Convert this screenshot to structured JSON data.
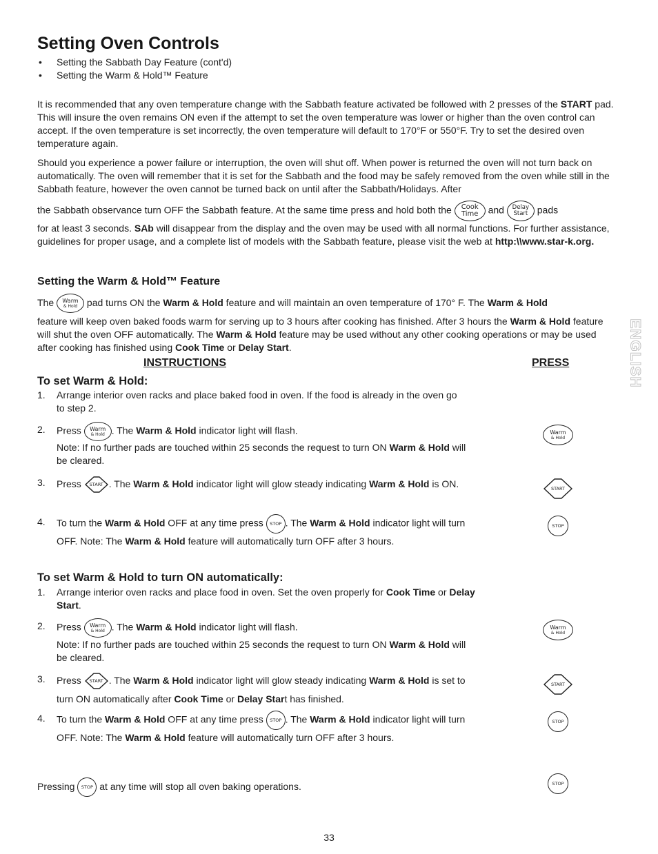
{
  "page": {
    "title": "Setting Oven Controls",
    "bullets": [
      "Setting the Sabbath Day Feature (cont'd)",
      "Setting the Warm & Hold™ Feature"
    ],
    "side_tab": "ENGLISH",
    "page_number": "33"
  },
  "pads": {
    "warm_line1": "Warm",
    "warm_line2": "& Hold",
    "start": "START",
    "stop": "STOP",
    "cook_line1": "Cook",
    "cook_line2": "Time",
    "delay_line1": "Delay",
    "delay_line2": "Start"
  },
  "sabbath": {
    "para1": {
      "a": "It is recommended that any oven temperature change with the Sabbath feature activated be followed with 2 presses of the ",
      "b": "START",
      "c": " pad. This will insure the oven remains ON even if the attempt to set the oven temperature was lower or higher than the oven control can accept. If the oven temperature is set incorrectly, the oven temperature will default to 170°F or 550°F. Try to set the desired oven temperature again."
    },
    "para2": {
      "a": "Should you experience a power failure or interruption, the oven will shut off. When power is returned the oven will not turn back on automatically. The oven will remember that it is set for the Sabbath and the food may be safely removed from the oven while still in the Sabbath feature, however the oven cannot be turned back on until after the Sabbath/Holidays. After",
      "b": "the Sabbath observance turn OFF the Sabbath feature. At the same time press and hold both the ",
      "c": " and ",
      "d": " pads",
      "e": "for at least 3 seconds. ",
      "f": "SAb",
      "g": " will disappear from the display and the oven may be used with all normal functions. For further assistance, guidelines for proper usage, and a complete list of models with the Sabbath feature, please visit the web at ",
      "h": "http:\\\\www.star-k.org."
    }
  },
  "warm_hold": {
    "heading": "Setting the Warm & Hold™ Feature",
    "intro": {
      "a": "The ",
      "b": " pad turns ON the ",
      "c": "Warm & Hold",
      "d": " feature and will maintain an oven temperature of 170° F. The ",
      "e": "Warm & Hold",
      "f": "feature will keep oven baked foods warm for serving up to 3 hours after cooking has finished. After 3 hours the ",
      "g": "Warm & Hold",
      "h": " feature will shut the oven OFF automatically. The ",
      "i": "Warm & Hold",
      "j": " feature may be used without any other cooking operations or may be used after cooking has finished using ",
      "k": "Cook Time",
      "l": " or ",
      "m": "Delay Start",
      "n": "."
    },
    "col_instructions": "INSTRUCTIONS",
    "col_press": "PRESS",
    "section1": {
      "heading": "To set Warm & Hold:",
      "steps": [
        {
          "num": "1.",
          "text": "Arrange interior oven racks and place baked food in oven. If the food is already in the oven go to step 2."
        },
        {
          "num": "2.",
          "a": "Press ",
          "b": ". The ",
          "c": "Warm & Hold",
          "d": " indicator light will flash.",
          "note_a": "Note: If no further pads are touched within 25 seconds the request to turn ON ",
          "note_b": "Warm & Hold",
          "note_c": " will be cleared.",
          "press": "warm"
        },
        {
          "num": "3.",
          "a": "Press ",
          "b": ". The ",
          "c": "Warm & Hold",
          "d": " indicator light will glow steady indicating ",
          "e": "Warm & Hold",
          "f": " is ON.",
          "press": "start"
        },
        {
          "num": "4.",
          "a": "To turn the ",
          "b": "Warm & Hold",
          "c": " OFF at any time press ",
          "d": ".  The ",
          "e": "Warm & Hold",
          "f": " indicator light will turn OFF. Note: The ",
          "g": "Warm & Hold",
          "h": " feature will automatically turn OFF after 3 hours.",
          "press": "stop"
        }
      ]
    },
    "section2": {
      "heading": "To set Warm & Hold to turn ON automatically:",
      "steps": [
        {
          "num": "1.",
          "a": "Arrange interior oven racks and place food in oven. Set the oven properly for ",
          "b": "Cook Time",
          "c": " or ",
          "d": "Delay Start",
          "e": "."
        },
        {
          "num": "2.",
          "a": "Press ",
          "b": ". The ",
          "c": "Warm & Hold",
          "d": " indicator light will flash.",
          "note_a": "Note: If no further pads are touched within 25 seconds the request to turn ON ",
          "note_b": "Warm & Hold",
          "note_c": " will be cleared.",
          "press": "warm"
        },
        {
          "num": "3.",
          "a": "Press ",
          "b": ". The ",
          "c": "Warm & Hold",
          "d": " indicator light will glow steady indicating ",
          "e": "Warm & Hold",
          "f": " is set to turn ON automatically after ",
          "g": "Cook Time",
          "h": " or ",
          "i": "Delay Star",
          "j": "t has finished.",
          "press": "start"
        },
        {
          "num": "4.",
          "a": "To turn the ",
          "b": "Warm & Hold",
          "c": " OFF at any time press ",
          "d": ". The ",
          "e": "Warm & Hold",
          "f": " indicator light will turn OFF. Note: The ",
          "g": "Warm & Hold",
          "h": " feature will automatically turn OFF after 3 hours.",
          "press": "stop"
        }
      ]
    },
    "footer_note": {
      "a": "Pressing ",
      "b": " at any time will stop all oven baking operations.",
      "press": "stop"
    }
  }
}
